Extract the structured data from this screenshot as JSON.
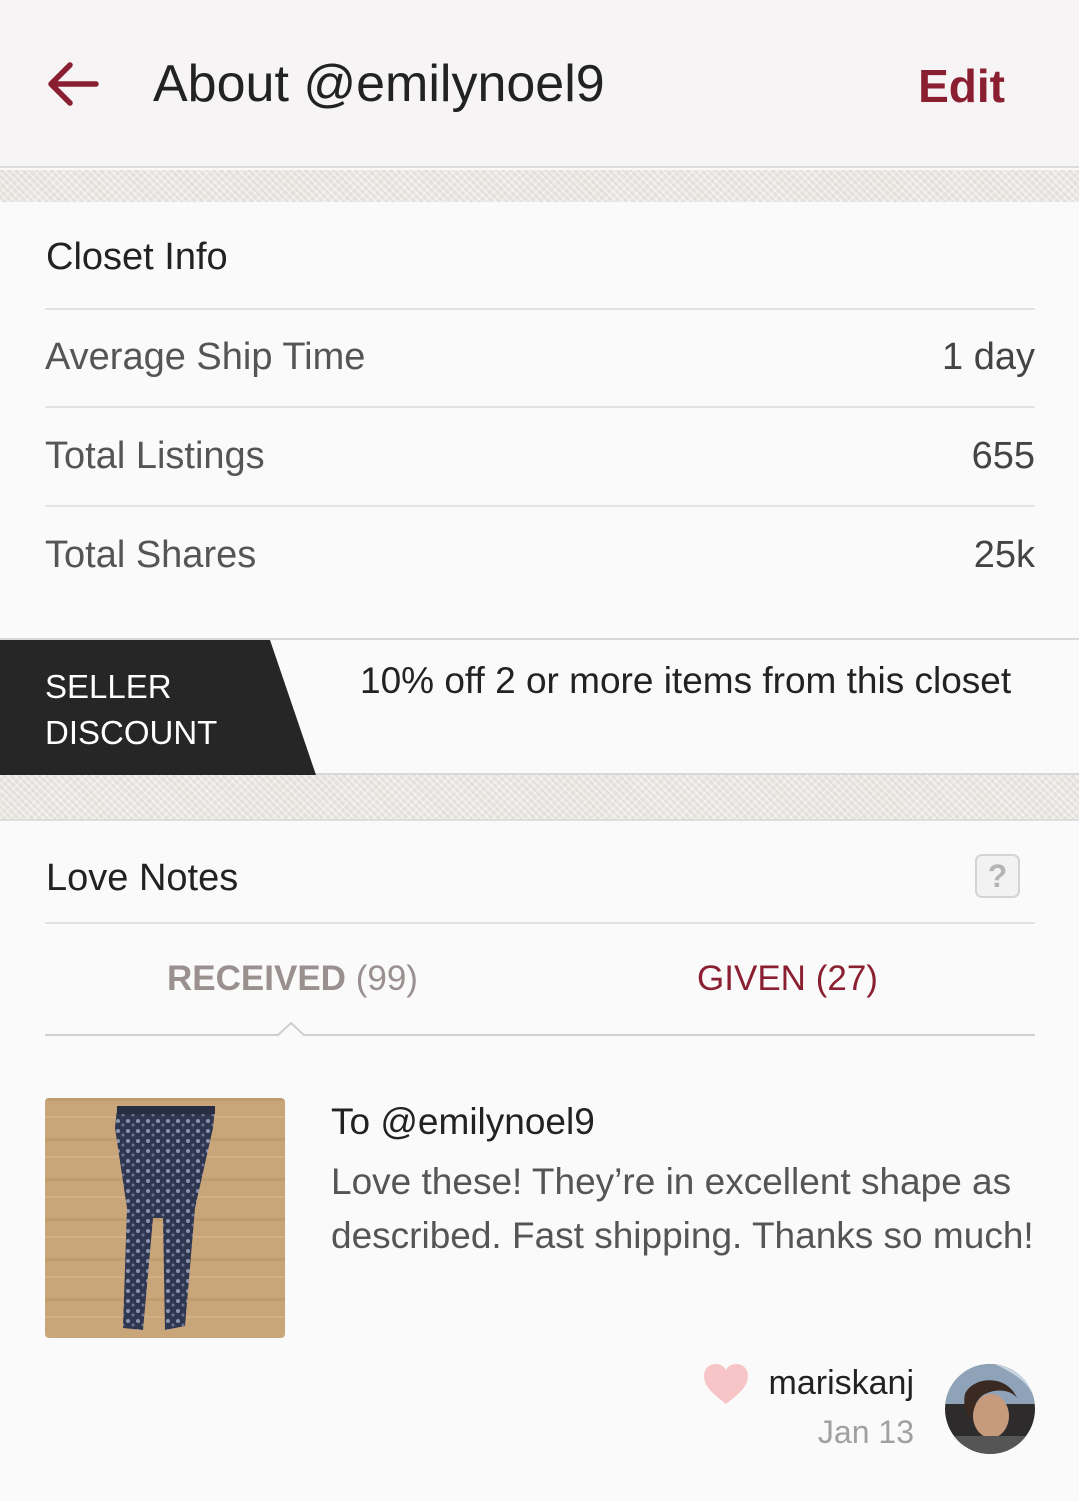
{
  "header": {
    "title": "About @emilynoel9",
    "edit_label": "Edit",
    "back_icon": "arrow-left-icon",
    "accent_color": "#8a1f31"
  },
  "closet_info": {
    "title": "Closet Info",
    "rows": [
      {
        "label": "Average Ship Time",
        "value": "1 day"
      },
      {
        "label": "Total Listings",
        "value": "655"
      },
      {
        "label": "Total Shares",
        "value": "25k"
      }
    ]
  },
  "seller_discount": {
    "badge_line1": "SELLER",
    "badge_line2": "DISCOUNT",
    "text": "10% off 2 or more items from this closet"
  },
  "love_notes": {
    "title": "Love Notes",
    "help_label": "?",
    "tabs": [
      {
        "label": "RECEIVED",
        "count": "(99)",
        "active": true
      },
      {
        "label": "GIVEN",
        "count": "(27)",
        "active": false
      }
    ],
    "note": {
      "to": "To @emilynoel9",
      "body": "Love these! They’re in excellent shape as described. Fast shipping. Thanks so much!",
      "username": "mariskanj",
      "date": "Jan 13",
      "heart_color": "#f7c5c8"
    }
  }
}
